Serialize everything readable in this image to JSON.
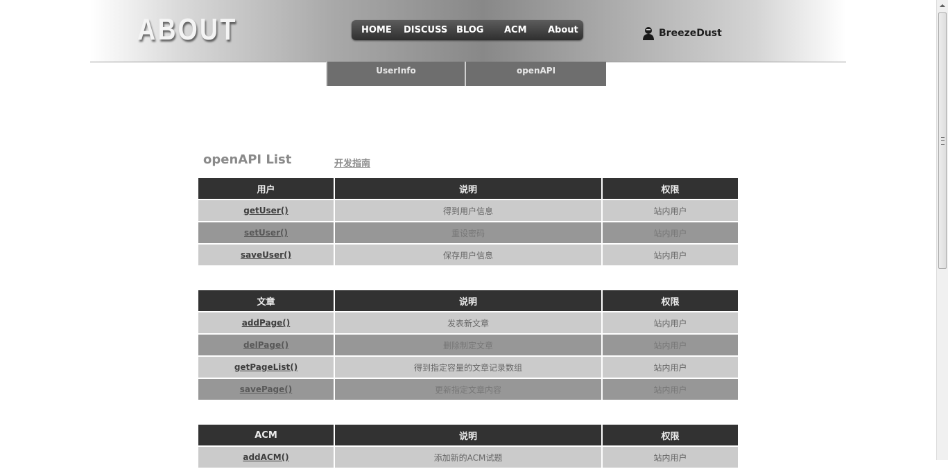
{
  "header": {
    "logo_text": "ABOUT",
    "nav": [
      {
        "label": "HOME"
      },
      {
        "label": "DISCUSS"
      },
      {
        "label": "BLOG"
      },
      {
        "label": "ACM"
      },
      {
        "label": "About"
      }
    ],
    "user": {
      "name": "BreezeDust",
      "icon": "user-silhouette-icon"
    }
  },
  "subtabs": [
    {
      "label": "UserInfo"
    },
    {
      "label": "openAPI"
    }
  ],
  "main": {
    "title": "openAPI List",
    "guide_link": "开发指南",
    "tables": [
      {
        "headers": [
          "用户",
          "说明",
          "权限"
        ],
        "rows": [
          [
            "getUser()",
            "得到用户信息",
            "站内用户"
          ],
          [
            "setUser()",
            "重设密码",
            "站内用户"
          ],
          [
            "saveUser()",
            "保存用户信息",
            "站内用户"
          ]
        ]
      },
      {
        "headers": [
          "文章",
          "说明",
          "权限"
        ],
        "rows": [
          [
            "addPage()",
            "发表新文章",
            "站内用户"
          ],
          [
            "delPage()",
            "删除制定文章",
            "站内用户"
          ],
          [
            "getPageList()",
            "得到指定容量的文章记录数组",
            "站内用户"
          ],
          [
            "savePage()",
            "更新指定文章内容",
            "站内用户"
          ]
        ]
      },
      {
        "headers": [
          "ACM",
          "说明",
          "权限"
        ],
        "rows": [
          [
            "addACM()",
            "添加新的ACM试题",
            "站内用户"
          ]
        ]
      }
    ]
  },
  "colors": {
    "header_dark": "#323232",
    "row_light": "#cbcbcb",
    "row_dark": "#979797",
    "subtab_bg": "#6e6e6e",
    "nav_bg": "#3a3a3a"
  }
}
